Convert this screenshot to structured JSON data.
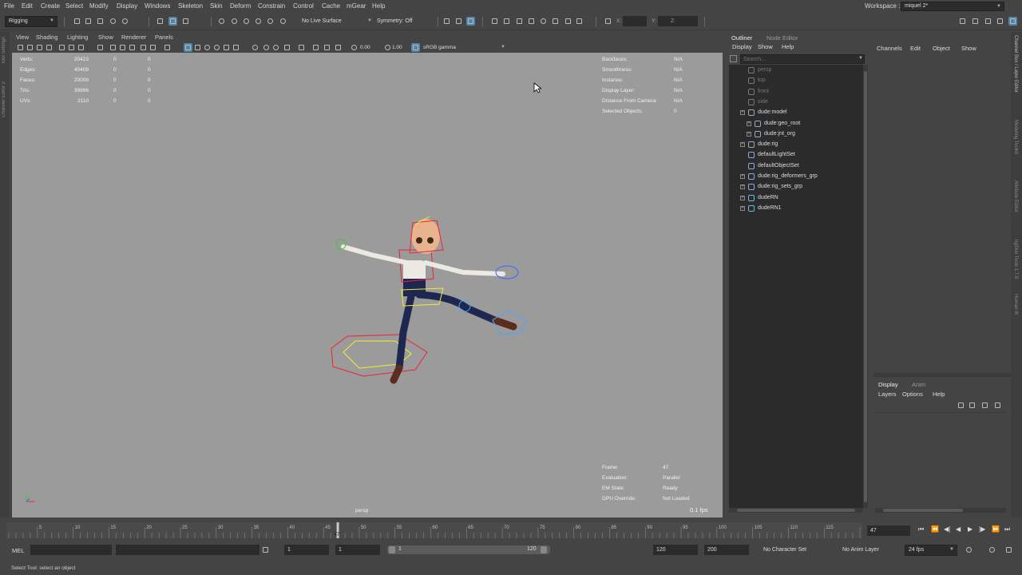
{
  "menubar": {
    "items": [
      "File",
      "Edit",
      "Create",
      "Select",
      "Modify",
      "Display",
      "Windows",
      "Skeleton",
      "Skin",
      "Deform",
      "Constrain",
      "Control",
      "Cache",
      "mGear",
      "Help"
    ],
    "workspace_label": "Workspace :",
    "workspace_value": "miquel 2*"
  },
  "statusline": {
    "menuset": "Rigging",
    "live_surface": "No Live Surface",
    "symmetry": "Symmetry: Off",
    "x_label": "X:",
    "y_label": "Y:",
    "z_label": "Z:"
  },
  "left_tabs": [
    "Tool Settings",
    "Channel Editor 2"
  ],
  "right_tabs": [
    "Channel Box / Layer Editor",
    "Modeling Toolkit",
    "Attribute Editor",
    "ngSkin Tools 1.7.8",
    "Human IK"
  ],
  "panel_menu": [
    "View",
    "Shading",
    "Lighting",
    "Show",
    "Renderer",
    "Panels"
  ],
  "viewport_toolbar": {
    "exposure": "0.00",
    "gamma": "1.00",
    "color_space": "sRGB gamma"
  },
  "hud_left": [
    {
      "label": "Verts:",
      "v1": "20423",
      "v2": "0",
      "v3": "0"
    },
    {
      "label": "Edges:",
      "v1": "40408",
      "v2": "0",
      "v3": "0"
    },
    {
      "label": "Faces:",
      "v1": "20009",
      "v2": "0",
      "v3": "0"
    },
    {
      "label": "Tris:",
      "v1": "39996",
      "v2": "0",
      "v3": "0"
    },
    {
      "label": "UVs:",
      "v1": "2110",
      "v2": "0",
      "v3": "0"
    }
  ],
  "hud_right": [
    {
      "label": "Backfaces:",
      "value": "N/A"
    },
    {
      "label": "Smoothness:",
      "value": "N/A"
    },
    {
      "label": "Instance:",
      "value": "N/A"
    },
    {
      "label": "Display Layer:",
      "value": "N/A"
    },
    {
      "label": "Distance From Camera:",
      "value": "N/A"
    },
    {
      "label": "Selected Objects:",
      "value": "0"
    }
  ],
  "hud_bottom": [
    {
      "label": "Frame:",
      "value": "47"
    },
    {
      "label": "Evaluation:",
      "value": "Parallel"
    },
    {
      "label": "EM State:",
      "value": "Ready"
    },
    {
      "label": "GPU Override:",
      "value": "Not Loaded"
    }
  ],
  "fps": "0.1 fps",
  "camera_name": "persp",
  "outliner": {
    "tabs": [
      "Outliner",
      "Node Editor"
    ],
    "menu": [
      "Display",
      "Show",
      "Help"
    ],
    "search_placeholder": "Search...",
    "items": [
      {
        "name": "persp",
        "dim": true,
        "expand": false,
        "indent": 0,
        "icon": "camera-icon"
      },
      {
        "name": "top",
        "dim": true,
        "expand": false,
        "indent": 0,
        "icon": "camera-icon"
      },
      {
        "name": "front",
        "dim": true,
        "expand": false,
        "indent": 0,
        "icon": "camera-icon"
      },
      {
        "name": "side",
        "dim": true,
        "expand": false,
        "indent": 0,
        "icon": "camera-icon"
      },
      {
        "name": "dude:model",
        "dim": false,
        "expand": true,
        "indent": 0,
        "icon": "group-icon"
      },
      {
        "name": "dude:geo_root",
        "dim": false,
        "expand": true,
        "indent": 1,
        "icon": "group-icon"
      },
      {
        "name": "dude:jnt_org",
        "dim": false,
        "expand": true,
        "indent": 1,
        "icon": "group-icon"
      },
      {
        "name": "dude:rig",
        "dim": false,
        "expand": true,
        "indent": 0,
        "icon": "transform-icon"
      },
      {
        "name": "defaultLightSet",
        "dim": false,
        "expand": false,
        "indent": 0,
        "icon": "set-icon"
      },
      {
        "name": "defaultObjectSet",
        "dim": false,
        "expand": false,
        "indent": 0,
        "icon": "set-icon"
      },
      {
        "name": "dude:rig_deformers_grp",
        "dim": false,
        "expand": true,
        "indent": 0,
        "icon": "set-icon"
      },
      {
        "name": "dude:rig_sets_grp",
        "dim": false,
        "expand": true,
        "indent": 0,
        "icon": "set-icon"
      },
      {
        "name": "dudeRN",
        "dim": false,
        "expand": true,
        "indent": 0,
        "icon": "reference-icon"
      },
      {
        "name": "dudeRN1",
        "dim": false,
        "expand": true,
        "indent": 0,
        "icon": "reference-icon"
      }
    ]
  },
  "channel_box": {
    "menu": [
      "Channels",
      "Edit",
      "Object",
      "Show"
    ]
  },
  "layer_editor": {
    "tabs": [
      "Display",
      "Anim"
    ],
    "menu": [
      "Layers",
      "Options",
      "Help"
    ]
  },
  "timeline": {
    "ticks": [
      "5",
      "10",
      "15",
      "20",
      "25",
      "30",
      "35",
      "40",
      "45",
      "50",
      "55",
      "60",
      "65",
      "70",
      "75",
      "80",
      "85",
      "90",
      "95",
      "100",
      "105",
      "110",
      "115",
      "120"
    ],
    "current_frame": "47",
    "current_field": "47"
  },
  "range": {
    "start": "1",
    "playback_start": "1",
    "slider_start": "1",
    "slider_end": "120",
    "playback_end": "120",
    "end": "200",
    "character_set": "No Character Set",
    "anim_layer": "No Anim Layer",
    "fps": "24 fps"
  },
  "command_line": {
    "lang": "MEL"
  },
  "help_line": "Select Tool: select an object"
}
